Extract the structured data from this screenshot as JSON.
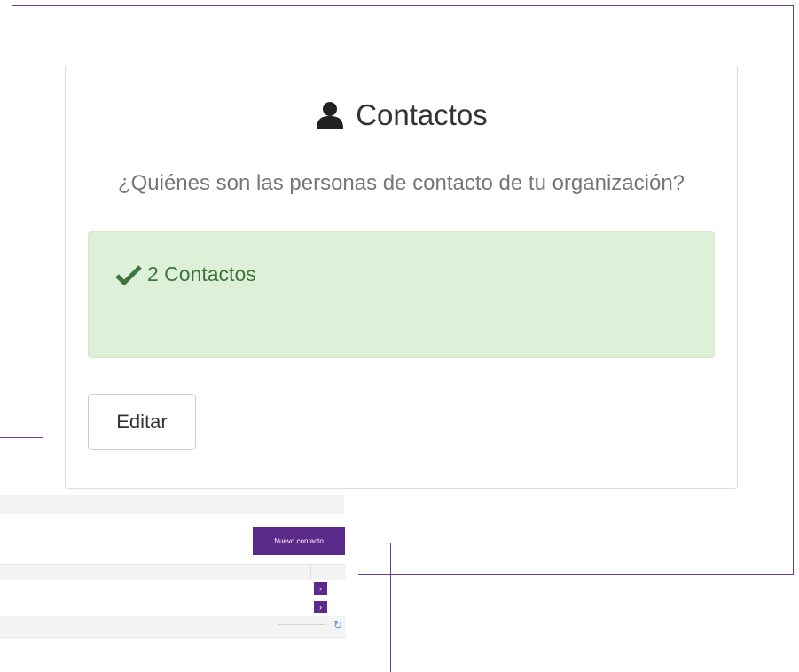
{
  "card": {
    "title": "Contactos",
    "question": "¿Quiénes son las personas de contacto de tu organización?",
    "alert_text": "2 Contactos",
    "edit_label": "Editar"
  },
  "background_table": {
    "new_button_label": "Nuevo contacto",
    "row_action_glyph": "›",
    "refresh_glyph": "↻"
  },
  "colors": {
    "accent_purple": "#5c2a8a",
    "frame_line": "#6b3f8f",
    "alert_bg": "#dff0d8",
    "alert_text": "#3c763d"
  },
  "icons": {
    "title_icon": "user-icon",
    "alert_icon": "check-icon",
    "row_action_icon": "chevron-right-icon",
    "footer_icon": "refresh-icon"
  }
}
